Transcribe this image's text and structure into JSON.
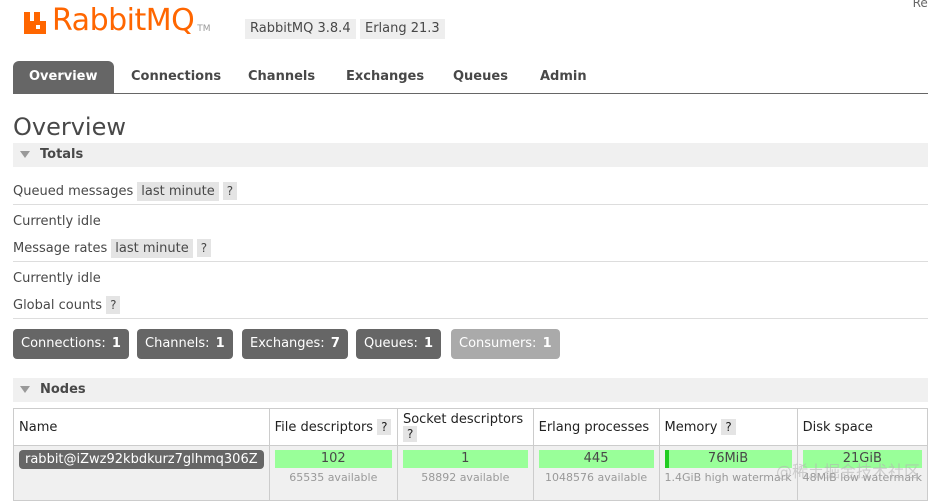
{
  "header": {
    "brand": "RabbitMQ",
    "tm": "TM",
    "rabbitmq_version": "RabbitMQ 3.8.4",
    "erlang_version": "Erlang 21.3",
    "refresh_fragment": "Ref"
  },
  "tabs": [
    "Overview",
    "Connections",
    "Channels",
    "Exchanges",
    "Queues",
    "Admin"
  ],
  "page_title": "Overview",
  "totals": {
    "header": "Totals",
    "queued_messages_label": "Queued messages",
    "queued_range": "last minute",
    "help": "?",
    "idle_1": "Currently idle",
    "message_rates_label": "Message rates",
    "message_range": "last minute",
    "idle_2": "Currently idle",
    "global_counts_label": "Global counts"
  },
  "counts": [
    {
      "label": "Connections:",
      "value": "1"
    },
    {
      "label": "Channels:",
      "value": "1"
    },
    {
      "label": "Exchanges:",
      "value": "7"
    },
    {
      "label": "Queues:",
      "value": "1"
    },
    {
      "label": "Consumers:",
      "value": "1"
    }
  ],
  "nodes": {
    "header": "Nodes",
    "columns": [
      "Name",
      "File descriptors",
      "Socket descriptors",
      "Erlang processes",
      "Memory",
      "Disk space"
    ],
    "row": {
      "name": "rabbit@iZwz92kbdkurz7glhmq306Z",
      "file_descriptors": "102",
      "file_descriptors_available": "65535 available",
      "socket_descriptors": "1",
      "socket_descriptors_available": "58892 available",
      "erlang_processes": "445",
      "erlang_processes_available": "1048576 available",
      "memory": "76MiB",
      "memory_watermark": "1.4GiB high watermark",
      "disk_space": "21GiB",
      "disk_watermark": "48MiB low watermark"
    }
  },
  "watermark": "@稀土掘金技术社区",
  "colors": {
    "brand": "#ff6600",
    "tab_active": "#666666",
    "bar_green": "#99ff99"
  }
}
